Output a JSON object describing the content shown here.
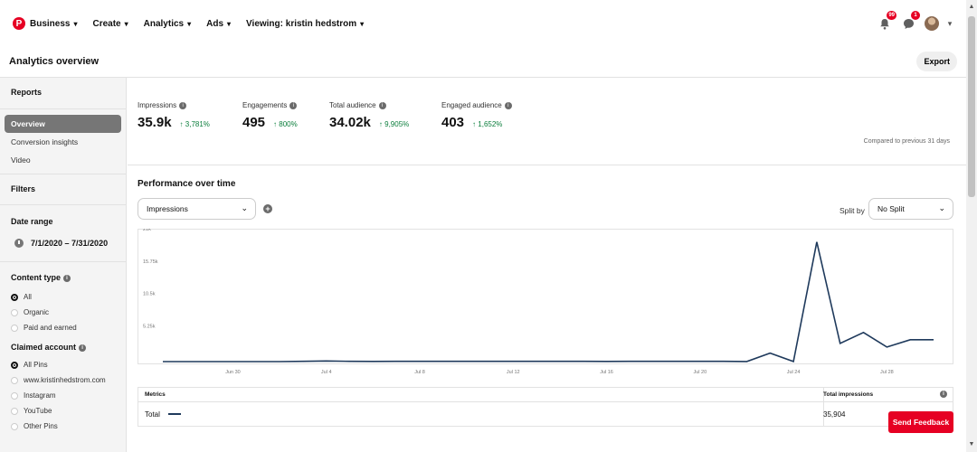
{
  "topnav": {
    "business": "Business",
    "create": "Create",
    "analytics": "Analytics",
    "ads": "Ads",
    "viewing": "Viewing: kristin hedstrom",
    "notifications_badge": "99",
    "messages_badge": "1"
  },
  "header": {
    "title": "Analytics overview",
    "export": "Export"
  },
  "sidebar": {
    "reports_heading": "Reports",
    "reports": [
      "Overview",
      "Conversion insights",
      "Video"
    ],
    "filters_heading": "Filters",
    "date_range_label": "Date range",
    "date_range": "7/1/2020 – 7/31/2020",
    "content_type_label": "Content type",
    "content_types": [
      "All",
      "Organic",
      "Paid and earned"
    ],
    "claimed_account_label": "Claimed account",
    "claimed_accounts": [
      "All Pins",
      "www.kristinhedstrom.com",
      "Instagram",
      "YouTube",
      "Other Pins"
    ]
  },
  "metrics": [
    {
      "label": "Impressions",
      "value": "35.9k",
      "change": "3,781%"
    },
    {
      "label": "Engagements",
      "value": "495",
      "change": "800%"
    },
    {
      "label": "Total audience",
      "value": "34.02k",
      "change": "9,905%"
    },
    {
      "label": "Engaged audience",
      "value": "403",
      "change": "1,652%"
    }
  ],
  "compare_text": "Compared to previous 31 days",
  "performance": {
    "title": "Performance over time",
    "metric_select": "Impressions",
    "split_label": "Split by",
    "split_select": "No Split"
  },
  "chart_data": {
    "type": "line",
    "yticks": [
      "21k",
      "15.75k",
      "10.5k",
      "5.25k"
    ],
    "ylim": [
      0,
      21000
    ],
    "xticks": [
      "Jun 30",
      "Jul 4",
      "Jul 8",
      "Jul 12",
      "Jul 16",
      "Jul 20",
      "Jul 24",
      "Jul 28"
    ],
    "x": [
      "Jun 27",
      "Jun 28",
      "Jun 29",
      "Jun 30",
      "Jul 1",
      "Jul 2",
      "Jul 3",
      "Jul 4",
      "Jul 5",
      "Jul 6",
      "Jul 7",
      "Jul 8",
      "Jul 9",
      "Jul 10",
      "Jul 11",
      "Jul 12",
      "Jul 13",
      "Jul 14",
      "Jul 15",
      "Jul 16",
      "Jul 17",
      "Jul 18",
      "Jul 19",
      "Jul 20",
      "Jul 21",
      "Jul 22",
      "Jul 23",
      "Jul 24",
      "Jul 25",
      "Jul 26",
      "Jul 27",
      "Jul 28",
      "Jul 29",
      "Jul 30"
    ],
    "series": [
      {
        "name": "Total",
        "values": [
          0,
          0,
          0,
          0,
          0,
          0,
          50,
          100,
          50,
          30,
          50,
          50,
          40,
          50,
          40,
          40,
          40,
          40,
          40,
          30,
          40,
          40,
          40,
          40,
          50,
          20,
          1400,
          10,
          19700,
          3000,
          4800,
          2400,
          3600,
          3600
        ]
      }
    ],
    "color": "#1f3a5c"
  },
  "table": {
    "metrics_header": "Metrics",
    "total_header": "Total impressions",
    "row_label": "Total",
    "row_value": "35,904"
  },
  "feedback_button": "Send Feedback"
}
